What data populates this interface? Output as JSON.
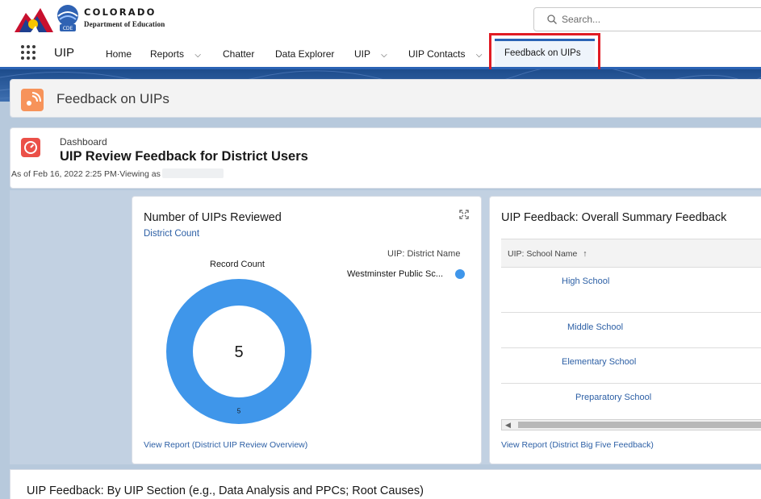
{
  "brand": {
    "line1": "COLORADO",
    "line2": "Department of Education",
    "badge_text": "CDE"
  },
  "search": {
    "placeholder": "Search...",
    "value": ""
  },
  "nav": {
    "app_name": "UIP",
    "items": [
      {
        "label": "Home"
      },
      {
        "label": "Reports",
        "dropdown": true
      },
      {
        "label": "Chatter"
      },
      {
        "label": "Data Explorer"
      },
      {
        "label": "UIP",
        "dropdown": true
      },
      {
        "label": "UIP Contacts",
        "dropdown": true
      }
    ],
    "active_tab": "Feedback on UIPs"
  },
  "page": {
    "title": "Feedback on UIPs"
  },
  "dashboard": {
    "label": "Dashboard",
    "title": "UIP Review Feedback for District Users",
    "as_of": "As of Feb 16, 2022 2:25 PM·Viewing as"
  },
  "card_reviewed": {
    "title": "Number of UIPs Reviewed",
    "subtitle": "District Count",
    "measure_label": "Record Count",
    "legend_title": "UIP: District Name",
    "link": "View Report (District UIP Review Overview)"
  },
  "chart_data": {
    "type": "pie",
    "donut": true,
    "title": "Record Count",
    "legend_title": "UIP: District Name",
    "legend_position": "top-right",
    "categories": [
      "Westminster Public Sc..."
    ],
    "values": [
      5
    ],
    "total_label": "5",
    "slice_labels": [
      "5"
    ],
    "colors": [
      "#3f96ea"
    ]
  },
  "card_feedback": {
    "title": "UIP Feedback: Overall Summary Feedback",
    "column_header": "UIP: School Name",
    "sort_indicator": "↑",
    "rows": [
      {
        "school": "High School"
      },
      {
        "school": "Middle School"
      },
      {
        "school": "Elementary School"
      },
      {
        "school": "Preparatory School"
      }
    ],
    "link": "View Report (District Big Five Feedback)"
  },
  "section_bottom": {
    "title": "UIP Feedback: By UIP Section (e.g., Data Analysis and PPCs; Root Causes)"
  },
  "colors": {
    "nav_accent": "#2a63b5",
    "highlight": "#e01b24",
    "link": "#2c5fa5",
    "chart": "#3f96ea",
    "page_icon": "#f7935a",
    "dashboard_icon": "#eb5048"
  }
}
